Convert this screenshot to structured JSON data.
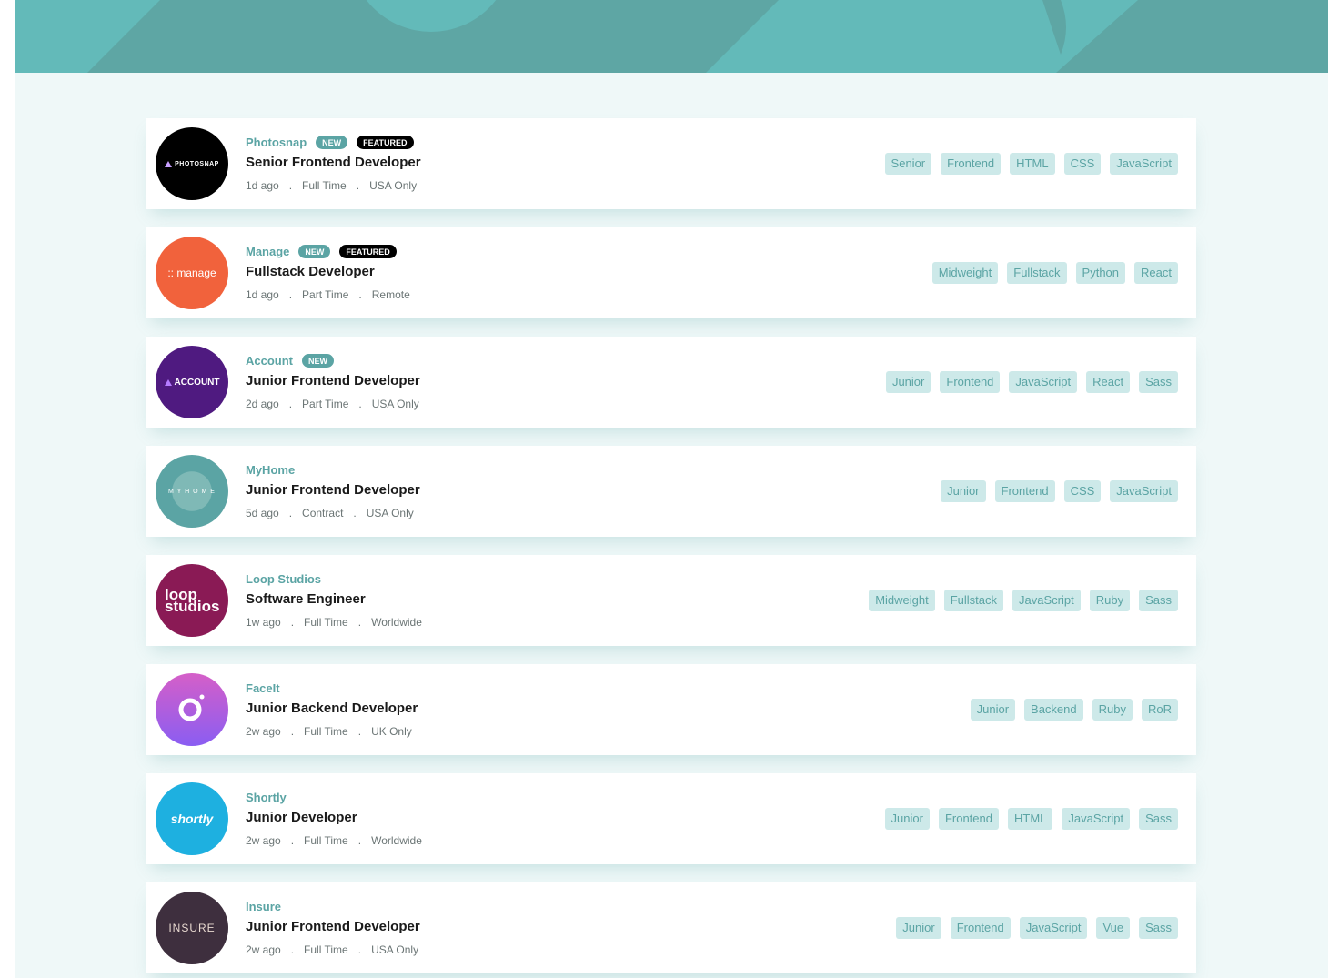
{
  "header": {
    "colors": {
      "base": "#63bab9",
      "shape": "#5ea6a4"
    }
  },
  "colors": {
    "accent": "#5ba4a4",
    "tag_bg": "#cde9e9",
    "featured": "#000000",
    "background": "#eff8f8"
  },
  "jobs": [
    {
      "company": "Photosnap",
      "logo_text": "PHOTOSNAP",
      "logo_icon": "triangle-icon",
      "logo_color": "#000000",
      "new_label": "NEW",
      "featured_label": "FEATURED",
      "position": "Senior Frontend Developer",
      "posted": "1d ago",
      "contract": "Full Time",
      "location": "USA Only",
      "tags": [
        "Senior",
        "Frontend",
        "HTML",
        "CSS",
        "JavaScript"
      ]
    },
    {
      "company": "Manage",
      "logo_text": ":: manage",
      "logo_icon": "dots-icon",
      "logo_color": "#f1623c",
      "new_label": "NEW",
      "featured_label": "FEATURED",
      "position": "Fullstack Developer",
      "posted": "1d ago",
      "contract": "Part Time",
      "location": "Remote",
      "tags": [
        "Midweight",
        "Fullstack",
        "Python",
        "React"
      ]
    },
    {
      "company": "Account",
      "logo_text": "ACCOUNT",
      "logo_icon": "triangle-icon",
      "logo_color": "#4f1a80",
      "new_label": "NEW",
      "featured_label": "",
      "position": "Junior Frontend Developer",
      "posted": "2d ago",
      "contract": "Part Time",
      "location": "USA Only",
      "tags": [
        "Junior",
        "Frontend",
        "JavaScript",
        "React",
        "Sass"
      ]
    },
    {
      "company": "MyHome",
      "logo_text": "M Y H O M E",
      "logo_icon": "",
      "logo_color": "#5ba4a4",
      "new_label": "",
      "featured_label": "",
      "position": "Junior Frontend Developer",
      "posted": "5d ago",
      "contract": "Contract",
      "location": "USA Only",
      "tags": [
        "Junior",
        "Frontend",
        "CSS",
        "JavaScript"
      ]
    },
    {
      "company": "Loop Studios",
      "logo_text": "loop studios",
      "logo_icon": "",
      "logo_color": "#8a1a55",
      "new_label": "",
      "featured_label": "",
      "position": "Software Engineer",
      "posted": "1w ago",
      "contract": "Full Time",
      "location": "Worldwide",
      "tags": [
        "Midweight",
        "Fullstack",
        "JavaScript",
        "Ruby",
        "Sass"
      ]
    },
    {
      "company": "FaceIt",
      "logo_text": "",
      "logo_icon": "ring-icon",
      "logo_color": "#a65fde",
      "new_label": "",
      "featured_label": "",
      "position": "Junior Backend Developer",
      "posted": "2w ago",
      "contract": "Full Time",
      "location": "UK Only",
      "tags": [
        "Junior",
        "Backend",
        "Ruby",
        "RoR"
      ]
    },
    {
      "company": "Shortly",
      "logo_text": "shortly",
      "logo_icon": "",
      "logo_color": "#1eb0e0",
      "new_label": "",
      "featured_label": "",
      "position": "Junior Developer",
      "posted": "2w ago",
      "contract": "Full Time",
      "location": "Worldwide",
      "tags": [
        "Junior",
        "Frontend",
        "HTML",
        "JavaScript",
        "Sass"
      ]
    },
    {
      "company": "Insure",
      "logo_text": "INSURE",
      "logo_icon": "",
      "logo_color": "#3e2f3e",
      "new_label": "",
      "featured_label": "",
      "position": "Junior Frontend Developer",
      "posted": "2w ago",
      "contract": "Full Time",
      "location": "USA Only",
      "tags": [
        "Junior",
        "Frontend",
        "JavaScript",
        "Vue",
        "Sass"
      ]
    }
  ]
}
